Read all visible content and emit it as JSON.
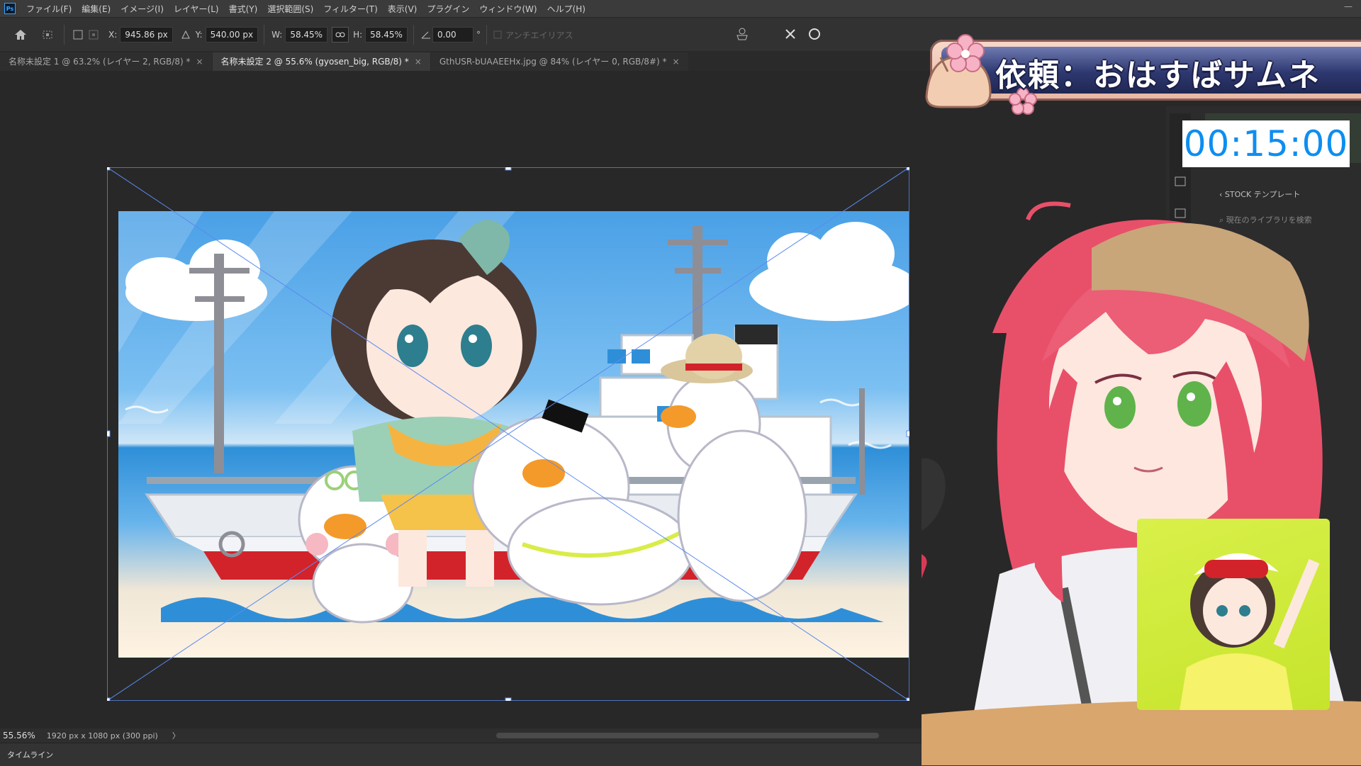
{
  "app": {
    "logo": "Ps"
  },
  "menu": [
    "ファイル(F)",
    "編集(E)",
    "イメージ(I)",
    "レイヤー(L)",
    "書式(Y)",
    "選択範囲(S)",
    "フィルター(T)",
    "表示(V)",
    "プラグイン",
    "ウィンドウ(W)",
    "ヘルプ(H)"
  ],
  "options": {
    "x_label": "X:",
    "x_value": "945.86 px",
    "y_label": "Y:",
    "y_value": "540.00 px",
    "w_label": "W:",
    "w_value": "58.45%",
    "h_label": "H:",
    "h_value": "58.45%",
    "angle_value": "0.00",
    "angle_unit": "°",
    "antialias_label": "アンチエイリアス"
  },
  "tabs": [
    {
      "label": "名称未設定 1 @ 63.2% (レイヤー 2, RGB/8) *",
      "active": false
    },
    {
      "label": "名称未設定 2 @ 55.6% (gyosen_big, RGB/8) *",
      "active": true
    },
    {
      "label": "GthUSR-bUAAEEHx.jpg @ 84% (レイヤー 0, RGB/8#) *",
      "active": false
    }
  ],
  "tab_close": "×",
  "status": {
    "zoom": "55.56%",
    "doc_info": "1920 px x 1080 px (300 ppi)",
    "arrow": "〉"
  },
  "timeline_label": "タイムライン",
  "side_panel": {
    "stock_label": "STOCK テンプレート",
    "search_placeholder": "現在のライブラリを検索"
  },
  "overlay": {
    "banner_text": "依頼：おはすばサムネ",
    "timer": "00:15:00"
  },
  "colors": {
    "accent": "#31a8ff",
    "banner_dark": "#2e3870",
    "timer": "#0d8ef0"
  }
}
